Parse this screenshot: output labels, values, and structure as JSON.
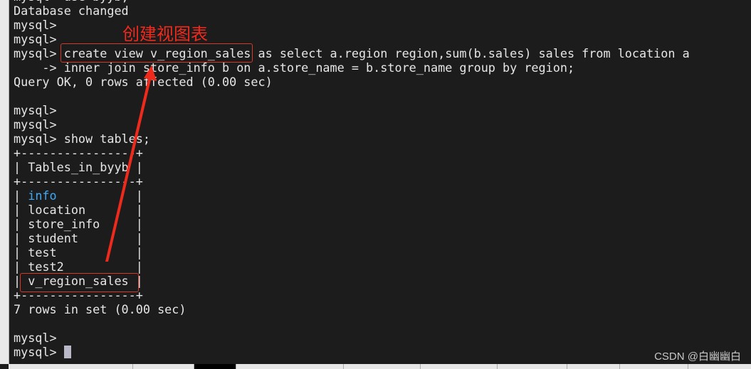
{
  "terminal": {
    "lines": [
      "mysql> use byyb;",
      "Database changed",
      "mysql>",
      "mysql>",
      "mysql> create view v_region_sales as select a.region region,sum(b.sales) sales from location a",
      "    -> inner join store_info b on a.store_name = b.store_name group by region;",
      "Query OK, 0 rows affected (0.00 sec)",
      "",
      "mysql>",
      "mysql>",
      "mysql> show tables;",
      "+----------------+",
      "| Tables_in_byyb |",
      "+----------------+"
    ],
    "table_rows": [
      "info",
      "location",
      "store_info",
      "student",
      "test",
      "test2",
      "v_region_sales"
    ],
    "after_lines": [
      "+----------------+",
      "7 rows in set (0.00 sec)",
      "",
      "mysql>"
    ],
    "prompt": "mysql> "
  },
  "annotation": {
    "label": "创建视图表",
    "color": "#ee2a1c"
  },
  "watermark": "CSDN @白幽幽白",
  "colors": {
    "background": "#1c1c1c",
    "text": "#e6e6e6",
    "highlight_row": "#3fa9f5"
  }
}
